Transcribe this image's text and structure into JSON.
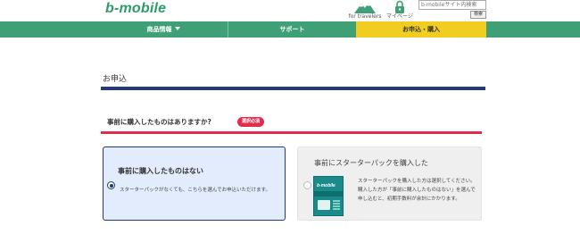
{
  "header": {
    "logo": "b-mobile",
    "travel_label": "for travelers",
    "mypage_label": "マイページ",
    "search_placeholder": "b-mobileサイト内検索",
    "search_button": "検索"
  },
  "nav": {
    "products": "商品情報",
    "support": "サポート",
    "apply": "お申込・購入"
  },
  "page": {
    "title": "お申込"
  },
  "question": {
    "text": "事前に購入したものはありますか?",
    "badge": "選択必須"
  },
  "options": [
    {
      "title": "事前に購入したものはない",
      "desc": "スターターパックがなくても、こちらを選んでお申込いただけます。",
      "selected": true
    },
    {
      "title": "事前にスターターパックを購入した",
      "desc": "スターターパックを購入した方は選択してください。購入した方が「事前に購入したものはない」を選んで申し込むと、初期手数料が余計にかかります。",
      "selected": false,
      "pack_label": "b-mobile"
    }
  ],
  "colors": {
    "brand_green": "#3f9f77",
    "apply_yellow": "#f2cd21",
    "navy": "#1f3b7b",
    "required_red": "#e12c4c"
  }
}
